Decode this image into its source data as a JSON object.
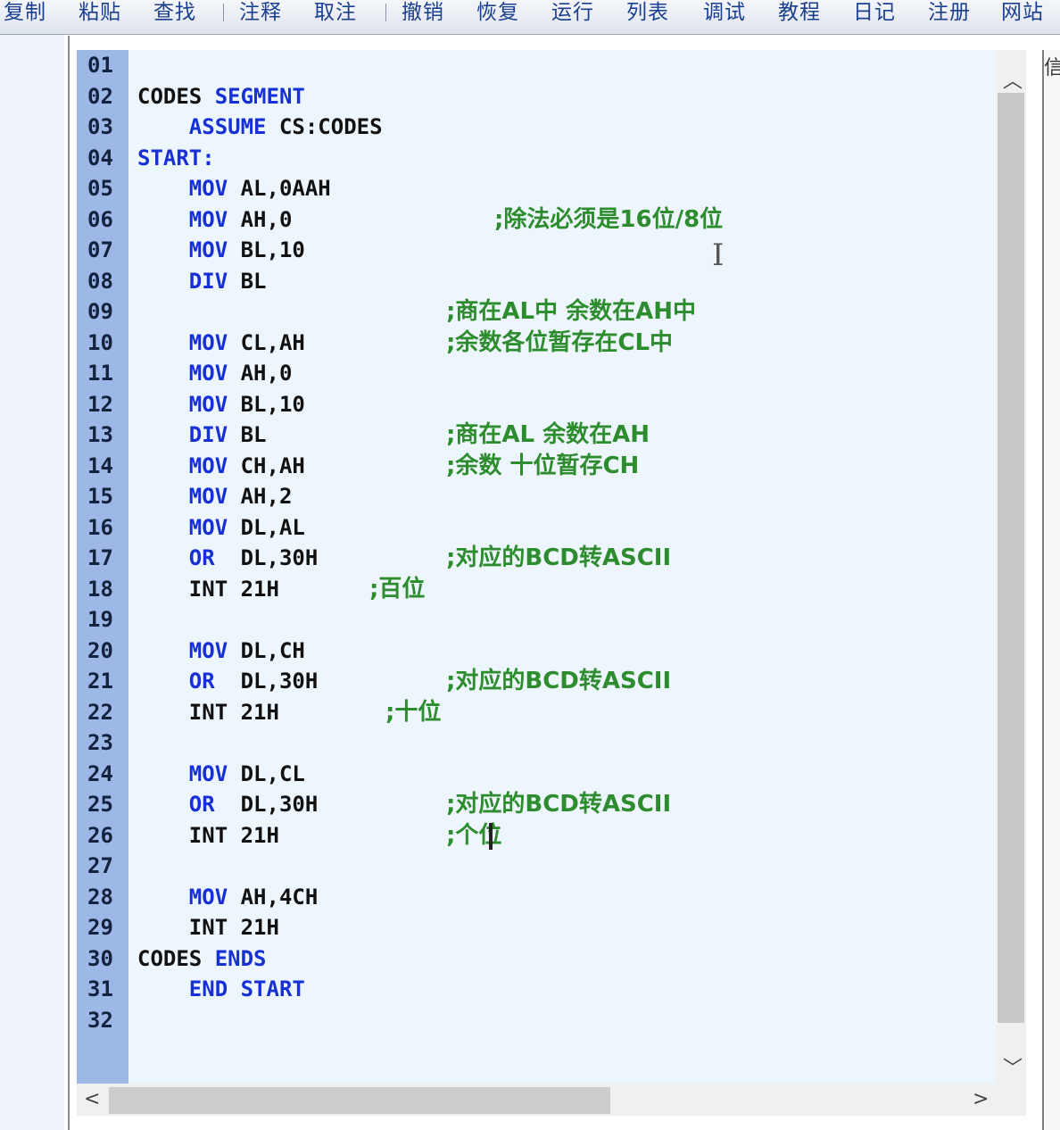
{
  "toolbar": {
    "items": [
      "复制",
      "粘贴",
      "查找",
      "注释",
      "取注",
      "撤销",
      "恢复",
      "运行",
      "列表",
      "调试",
      "教程",
      "日记",
      "注册",
      "网站"
    ]
  },
  "side_panel_label": "信",
  "editor": {
    "lines": [
      {
        "n": "01",
        "segs": []
      },
      {
        "n": "02",
        "segs": [
          [
            "CODES ",
            "t"
          ],
          [
            "SEGMENT",
            "k"
          ]
        ]
      },
      {
        "n": "03",
        "segs": [
          [
            "    ",
            ""
          ],
          [
            "ASSUME",
            "k"
          ],
          [
            " CS:CODES",
            "t"
          ]
        ]
      },
      {
        "n": "04",
        "segs": [
          [
            "START:",
            "k"
          ]
        ]
      },
      {
        "n": "05",
        "segs": [
          [
            "    ",
            ""
          ],
          [
            "MOV",
            "k"
          ],
          [
            " AL,0AAH",
            "t"
          ]
        ]
      },
      {
        "n": "06",
        "segs": [
          [
            "    ",
            ""
          ],
          [
            "MOV",
            "k"
          ],
          [
            " AH,0",
            "t"
          ]
        ],
        "comment": ";除法必须是16位/8位"
      },
      {
        "n": "07",
        "segs": [
          [
            "    ",
            ""
          ],
          [
            "MOV",
            "k"
          ],
          [
            " BL,10",
            "t"
          ]
        ]
      },
      {
        "n": "08",
        "segs": [
          [
            "    ",
            ""
          ],
          [
            "DIV",
            "k"
          ],
          [
            " BL",
            "t"
          ]
        ]
      },
      {
        "n": "09",
        "segs": [],
        "comment": ";商在AL中 余数在AH中"
      },
      {
        "n": "10",
        "segs": [
          [
            "    ",
            ""
          ],
          [
            "MOV",
            "k"
          ],
          [
            " CL,AH",
            "t"
          ]
        ],
        "comment": ";余数各位暂存在CL中"
      },
      {
        "n": "11",
        "segs": [
          [
            "    ",
            ""
          ],
          [
            "MOV",
            "k"
          ],
          [
            " AH,0",
            "t"
          ]
        ]
      },
      {
        "n": "12",
        "segs": [
          [
            "    ",
            ""
          ],
          [
            "MOV",
            "k"
          ],
          [
            " BL,10",
            "t"
          ]
        ]
      },
      {
        "n": "13",
        "segs": [
          [
            "    ",
            ""
          ],
          [
            "DIV",
            "k"
          ],
          [
            " BL",
            "t"
          ]
        ],
        "comment": ";商在AL 余数在AH"
      },
      {
        "n": "14",
        "segs": [
          [
            "    ",
            ""
          ],
          [
            "MOV",
            "k"
          ],
          [
            " CH,AH",
            "t"
          ]
        ],
        "comment": ";余数 十位暂存CH"
      },
      {
        "n": "15",
        "segs": [
          [
            "    ",
            ""
          ],
          [
            "MOV",
            "k"
          ],
          [
            " AH,2",
            "t"
          ]
        ]
      },
      {
        "n": "16",
        "segs": [
          [
            "    ",
            ""
          ],
          [
            "MOV",
            "k"
          ],
          [
            " DL,AL",
            "t"
          ]
        ]
      },
      {
        "n": "17",
        "segs": [
          [
            "    ",
            ""
          ],
          [
            "OR",
            "k"
          ],
          [
            "  DL,30H",
            "t"
          ]
        ],
        "comment": ";对应的BCD转ASCII"
      },
      {
        "n": "18",
        "segs": [
          [
            "    ",
            ""
          ],
          [
            "INT 21H",
            "t"
          ]
        ],
        "comment": ";百位"
      },
      {
        "n": "19",
        "segs": []
      },
      {
        "n": "20",
        "segs": [
          [
            "    ",
            ""
          ],
          [
            "MOV",
            "k"
          ],
          [
            " DL,CH",
            "t"
          ]
        ]
      },
      {
        "n": "21",
        "segs": [
          [
            "    ",
            ""
          ],
          [
            "OR",
            "k"
          ],
          [
            "  DL,30H",
            "t"
          ]
        ],
        "comment": ";对应的BCD转ASCII"
      },
      {
        "n": "22",
        "segs": [
          [
            "    ",
            ""
          ],
          [
            "INT 21H",
            "t"
          ]
        ],
        "comment": ";十位"
      },
      {
        "n": "23",
        "segs": []
      },
      {
        "n": "24",
        "segs": [
          [
            "    ",
            ""
          ],
          [
            "MOV",
            "k"
          ],
          [
            " DL,CL",
            "t"
          ]
        ]
      },
      {
        "n": "25",
        "segs": [
          [
            "    ",
            ""
          ],
          [
            "OR",
            "k"
          ],
          [
            "  DL,30H",
            "t"
          ]
        ],
        "comment": ";对应的BCD转ASCII"
      },
      {
        "n": "26",
        "segs": [
          [
            "    ",
            ""
          ],
          [
            "INT 21H",
            "t"
          ]
        ],
        "comment": ";个位"
      },
      {
        "n": "27",
        "segs": []
      },
      {
        "n": "28",
        "segs": [
          [
            "    ",
            ""
          ],
          [
            "MOV",
            "k"
          ],
          [
            " AH,4CH",
            "t"
          ]
        ]
      },
      {
        "n": "29",
        "segs": [
          [
            "    ",
            ""
          ],
          [
            "INT 21H",
            "t"
          ]
        ]
      },
      {
        "n": "30",
        "segs": [
          [
            "CODES ",
            "t"
          ],
          [
            "ENDS",
            "k"
          ]
        ]
      },
      {
        "n": "31",
        "segs": [
          [
            "    ",
            ""
          ],
          [
            "END START",
            "k"
          ]
        ]
      },
      {
        "n": "32",
        "segs": []
      }
    ]
  },
  "icons": {
    "scroll_up": "chevron-up-icon",
    "scroll_down": "chevron-down-icon",
    "scroll_left": "chevron-left-icon",
    "scroll_right": "chevron-right-icon"
  },
  "colors": {
    "keyword": "#1630d6",
    "comment": "#2d8c2d",
    "gutter": "#9db7e6",
    "editor_bg": "#eef6fd"
  }
}
